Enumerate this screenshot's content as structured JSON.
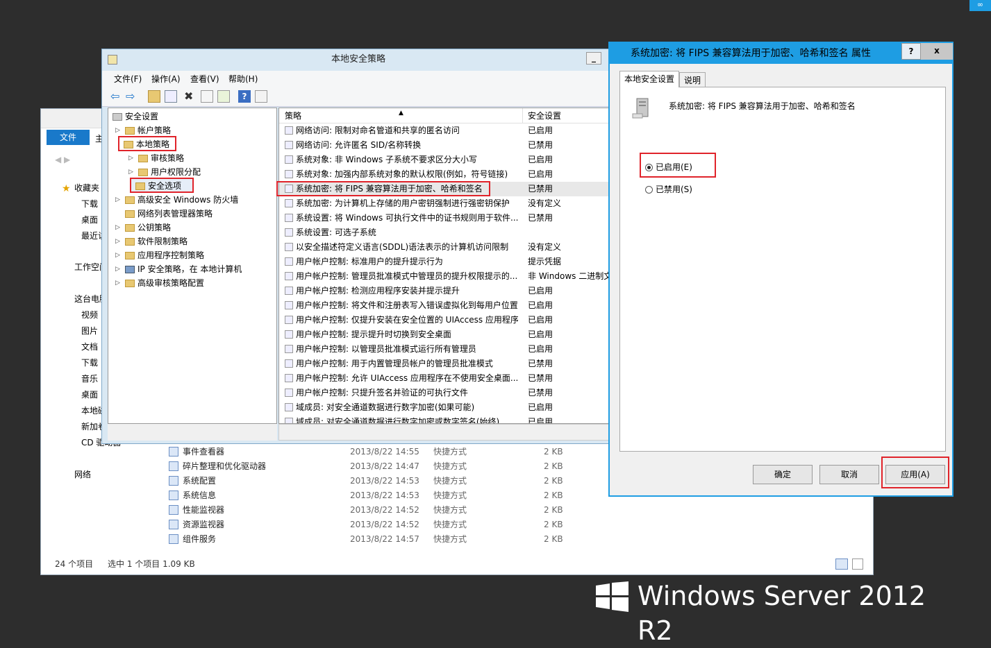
{
  "explorer": {
    "ribbon_tab": "文件",
    "ribbon_tab2": "主",
    "nav": [
      {
        "label": "收藏夹"
      },
      {
        "label": "下载"
      },
      {
        "label": "桌面"
      },
      {
        "label": "最近访"
      },
      {
        "label": "工作空间"
      },
      {
        "label": "这台电脑"
      },
      {
        "label": "视频"
      },
      {
        "label": "图片"
      },
      {
        "label": "文档"
      },
      {
        "label": "下载"
      },
      {
        "label": "音乐"
      },
      {
        "label": "桌面"
      },
      {
        "label": "本地磁"
      },
      {
        "label": "新加卷"
      },
      {
        "label": "CD 驱动器"
      },
      {
        "label": "网络"
      }
    ],
    "files": [
      {
        "name": "事件查看器",
        "date": "2013/8/22 14:55",
        "type": "快捷方式",
        "size": "2 KB"
      },
      {
        "name": "碎片整理和优化驱动器",
        "date": "2013/8/22 14:47",
        "type": "快捷方式",
        "size": "2 KB"
      },
      {
        "name": "系统配置",
        "date": "2013/8/22 14:53",
        "type": "快捷方式",
        "size": "2 KB"
      },
      {
        "name": "系统信息",
        "date": "2013/8/22 14:53",
        "type": "快捷方式",
        "size": "2 KB"
      },
      {
        "name": "性能监视器",
        "date": "2013/8/22 14:52",
        "type": "快捷方式",
        "size": "2 KB"
      },
      {
        "name": "资源监视器",
        "date": "2013/8/22 14:52",
        "type": "快捷方式",
        "size": "2 KB"
      },
      {
        "name": "组件服务",
        "date": "2013/8/22 14:57",
        "type": "快捷方式",
        "size": "2 KB"
      }
    ],
    "status_items": "24 个项目",
    "status_selected": "选中 1 个项目  1.09 KB"
  },
  "secpol": {
    "title": "本地安全策略",
    "menu": [
      "文件(F)",
      "操作(A)",
      "查看(V)",
      "帮助(H)"
    ],
    "tree": [
      {
        "label": "安全设置"
      },
      {
        "label": "帐户策略"
      },
      {
        "label": "本地策略"
      },
      {
        "label": "审核策略"
      },
      {
        "label": "用户权限分配"
      },
      {
        "label": "安全选项"
      },
      {
        "label": "高级安全 Windows 防火墙"
      },
      {
        "label": "网络列表管理器策略"
      },
      {
        "label": "公钥策略"
      },
      {
        "label": "软件限制策略"
      },
      {
        "label": "应用程序控制策略"
      },
      {
        "label": "IP 安全策略，在 本地计算机"
      },
      {
        "label": "高级审核策略配置"
      }
    ],
    "col_policy": "策略",
    "col_setting": "安全设置",
    "rows": [
      {
        "policy": "网络访问: 限制对命名管道和共享的匿名访问",
        "setting": "已启用"
      },
      {
        "policy": "网络访问: 允许匿名 SID/名称转换",
        "setting": "已禁用"
      },
      {
        "policy": "系统对象: 非 Windows 子系统不要求区分大小写",
        "setting": "已启用"
      },
      {
        "policy": "系统对象: 加强内部系统对象的默认权限(例如，符号链接)",
        "setting": "已启用"
      },
      {
        "policy": "系统加密: 将 FIPS 兼容算法用于加密、哈希和签名",
        "setting": "已禁用"
      },
      {
        "policy": "系统加密: 为计算机上存储的用户密钥强制进行强密钥保护",
        "setting": "没有定义"
      },
      {
        "policy": "系统设置: 将 Windows 可执行文件中的证书规则用于软件...",
        "setting": "已禁用"
      },
      {
        "policy": "系统设置: 可选子系统",
        "setting": ""
      },
      {
        "policy": "以安全描述符定义语言(SDDL)语法表示的计算机访问限制",
        "setting": "没有定义"
      },
      {
        "policy": "用户帐户控制: 标准用户的提升提示行为",
        "setting": "提示凭据"
      },
      {
        "policy": "用户帐户控制: 管理员批准模式中管理员的提升权限提示的...",
        "setting": "非 Windows 二进制文"
      },
      {
        "policy": "用户帐户控制: 检测应用程序安装并提示提升",
        "setting": "已启用"
      },
      {
        "policy": "用户帐户控制: 将文件和注册表写入错误虚拟化到每用户位置",
        "setting": "已启用"
      },
      {
        "policy": "用户帐户控制: 仅提升安装在安全位置的 UIAccess 应用程序",
        "setting": "已启用"
      },
      {
        "policy": "用户帐户控制: 提示提升时切换到安全桌面",
        "setting": "已启用"
      },
      {
        "policy": "用户帐户控制: 以管理员批准模式运行所有管理员",
        "setting": "已启用"
      },
      {
        "policy": "用户帐户控制: 用于内置管理员帐户的管理员批准模式",
        "setting": "已禁用"
      },
      {
        "policy": "用户帐户控制: 允许 UIAccess 应用程序在不使用安全桌面...",
        "setting": "已禁用"
      },
      {
        "policy": "用户帐户控制: 只提升签名并验证的可执行文件",
        "setting": "已禁用"
      },
      {
        "policy": "域成员: 对安全通道数据进行数字加密(如果可能)",
        "setting": "已启用"
      },
      {
        "policy": "域成员: 对安全通道数据进行数字加密或数字签名(始终)",
        "setting": "已启用"
      }
    ]
  },
  "dialog": {
    "title": "系统加密: 将 FIPS 兼容算法用于加密、哈希和签名 属性",
    "help": "?",
    "close": "x",
    "tab_local": "本地安全设置",
    "tab_explain": "说明",
    "policy_name": "系统加密: 将 FIPS 兼容算法用于加密、哈希和签名",
    "radio_enabled": "已启用(E)",
    "radio_disabled": "已禁用(S)",
    "ok": "确定",
    "cancel": "取消",
    "apply": "应用(A)"
  },
  "brand": "Windows Server 2012 R2",
  "badge": "∞"
}
